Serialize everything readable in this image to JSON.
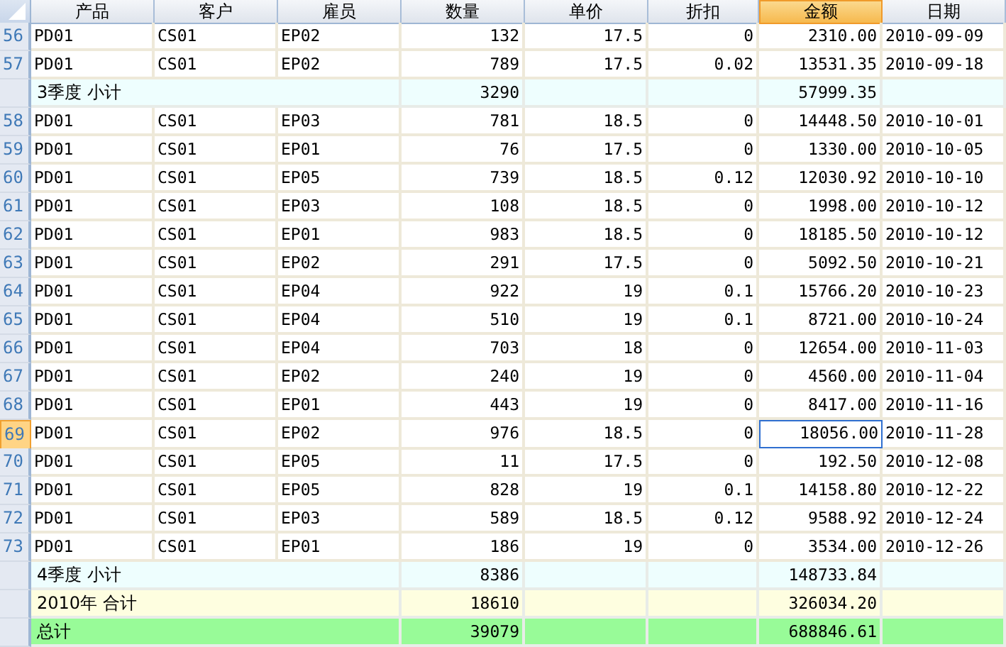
{
  "columns": [
    {
      "label": "产品",
      "selected": false
    },
    {
      "label": "客户",
      "selected": false
    },
    {
      "label": "雇员",
      "selected": false
    },
    {
      "label": "数量",
      "selected": false
    },
    {
      "label": "单价",
      "selected": false
    },
    {
      "label": "折扣",
      "selected": false
    },
    {
      "label": "金额",
      "selected": true
    },
    {
      "label": "日期",
      "selected": false
    }
  ],
  "rows": [
    {
      "kind": "data",
      "number": "56",
      "selected": false,
      "cells": [
        "PD01",
        "CS01",
        "EP02",
        "132",
        "17.5",
        "0",
        "2310.00",
        "2010-09-09"
      ]
    },
    {
      "kind": "data",
      "number": "57",
      "selected": false,
      "cells": [
        "PD01",
        "CS01",
        "EP02",
        "789",
        "17.5",
        "0.02",
        "13531.35",
        "2010-09-18"
      ]
    },
    {
      "kind": "quarter",
      "label": "3季度 小计",
      "quantity": "3290",
      "amount": "57999.35"
    },
    {
      "kind": "data",
      "number": "58",
      "selected": false,
      "cells": [
        "PD01",
        "CS01",
        "EP03",
        "781",
        "18.5",
        "0",
        "14448.50",
        "2010-10-01"
      ]
    },
    {
      "kind": "data",
      "number": "59",
      "selected": false,
      "cells": [
        "PD01",
        "CS01",
        "EP01",
        "76",
        "17.5",
        "0",
        "1330.00",
        "2010-10-05"
      ]
    },
    {
      "kind": "data",
      "number": "60",
      "selected": false,
      "cells": [
        "PD01",
        "CS01",
        "EP05",
        "739",
        "18.5",
        "0.12",
        "12030.92",
        "2010-10-10"
      ]
    },
    {
      "kind": "data",
      "number": "61",
      "selected": false,
      "cells": [
        "PD01",
        "CS01",
        "EP03",
        "108",
        "18.5",
        "0",
        "1998.00",
        "2010-10-12"
      ]
    },
    {
      "kind": "data",
      "number": "62",
      "selected": false,
      "cells": [
        "PD01",
        "CS01",
        "EP01",
        "983",
        "18.5",
        "0",
        "18185.50",
        "2010-10-12"
      ]
    },
    {
      "kind": "data",
      "number": "63",
      "selected": false,
      "cells": [
        "PD01",
        "CS01",
        "EP02",
        "291",
        "17.5",
        "0",
        "5092.50",
        "2010-10-21"
      ]
    },
    {
      "kind": "data",
      "number": "64",
      "selected": false,
      "cells": [
        "PD01",
        "CS01",
        "EP04",
        "922",
        "19",
        "0.1",
        "15766.20",
        "2010-10-23"
      ]
    },
    {
      "kind": "data",
      "number": "65",
      "selected": false,
      "cells": [
        "PD01",
        "CS01",
        "EP04",
        "510",
        "19",
        "0.1",
        "8721.00",
        "2010-10-24"
      ]
    },
    {
      "kind": "data",
      "number": "66",
      "selected": false,
      "cells": [
        "PD01",
        "CS01",
        "EP04",
        "703",
        "18",
        "0",
        "12654.00",
        "2010-11-03"
      ]
    },
    {
      "kind": "data",
      "number": "67",
      "selected": false,
      "cells": [
        "PD01",
        "CS01",
        "EP02",
        "240",
        "19",
        "0",
        "4560.00",
        "2010-11-04"
      ]
    },
    {
      "kind": "data",
      "number": "68",
      "selected": false,
      "cells": [
        "PD01",
        "CS01",
        "EP01",
        "443",
        "19",
        "0",
        "8417.00",
        "2010-11-16"
      ]
    },
    {
      "kind": "data",
      "number": "69",
      "selected": true,
      "cells": [
        "PD01",
        "CS01",
        "EP02",
        "976",
        "18.5",
        "0",
        "18056.00",
        "2010-11-28"
      ]
    },
    {
      "kind": "data",
      "number": "70",
      "selected": false,
      "cells": [
        "PD01",
        "CS01",
        "EP05",
        "11",
        "17.5",
        "0",
        "192.50",
        "2010-12-08"
      ]
    },
    {
      "kind": "data",
      "number": "71",
      "selected": false,
      "cells": [
        "PD01",
        "CS01",
        "EP05",
        "828",
        "19",
        "0.1",
        "14158.80",
        "2010-12-22"
      ]
    },
    {
      "kind": "data",
      "number": "72",
      "selected": false,
      "cells": [
        "PD01",
        "CS01",
        "EP03",
        "589",
        "18.5",
        "0.12",
        "9588.92",
        "2010-12-24"
      ]
    },
    {
      "kind": "data",
      "number": "73",
      "selected": false,
      "cells": [
        "PD01",
        "CS01",
        "EP01",
        "186",
        "19",
        "0",
        "3534.00",
        "2010-12-26"
      ]
    },
    {
      "kind": "quarter",
      "label": "4季度 小计",
      "quantity": "8386",
      "amount": "148733.84"
    },
    {
      "kind": "year",
      "label": "2010年 合计",
      "quantity": "18610",
      "amount": "326034.20"
    },
    {
      "kind": "total",
      "label": "总计",
      "quantity": "39079",
      "amount": "688846.61"
    }
  ]
}
